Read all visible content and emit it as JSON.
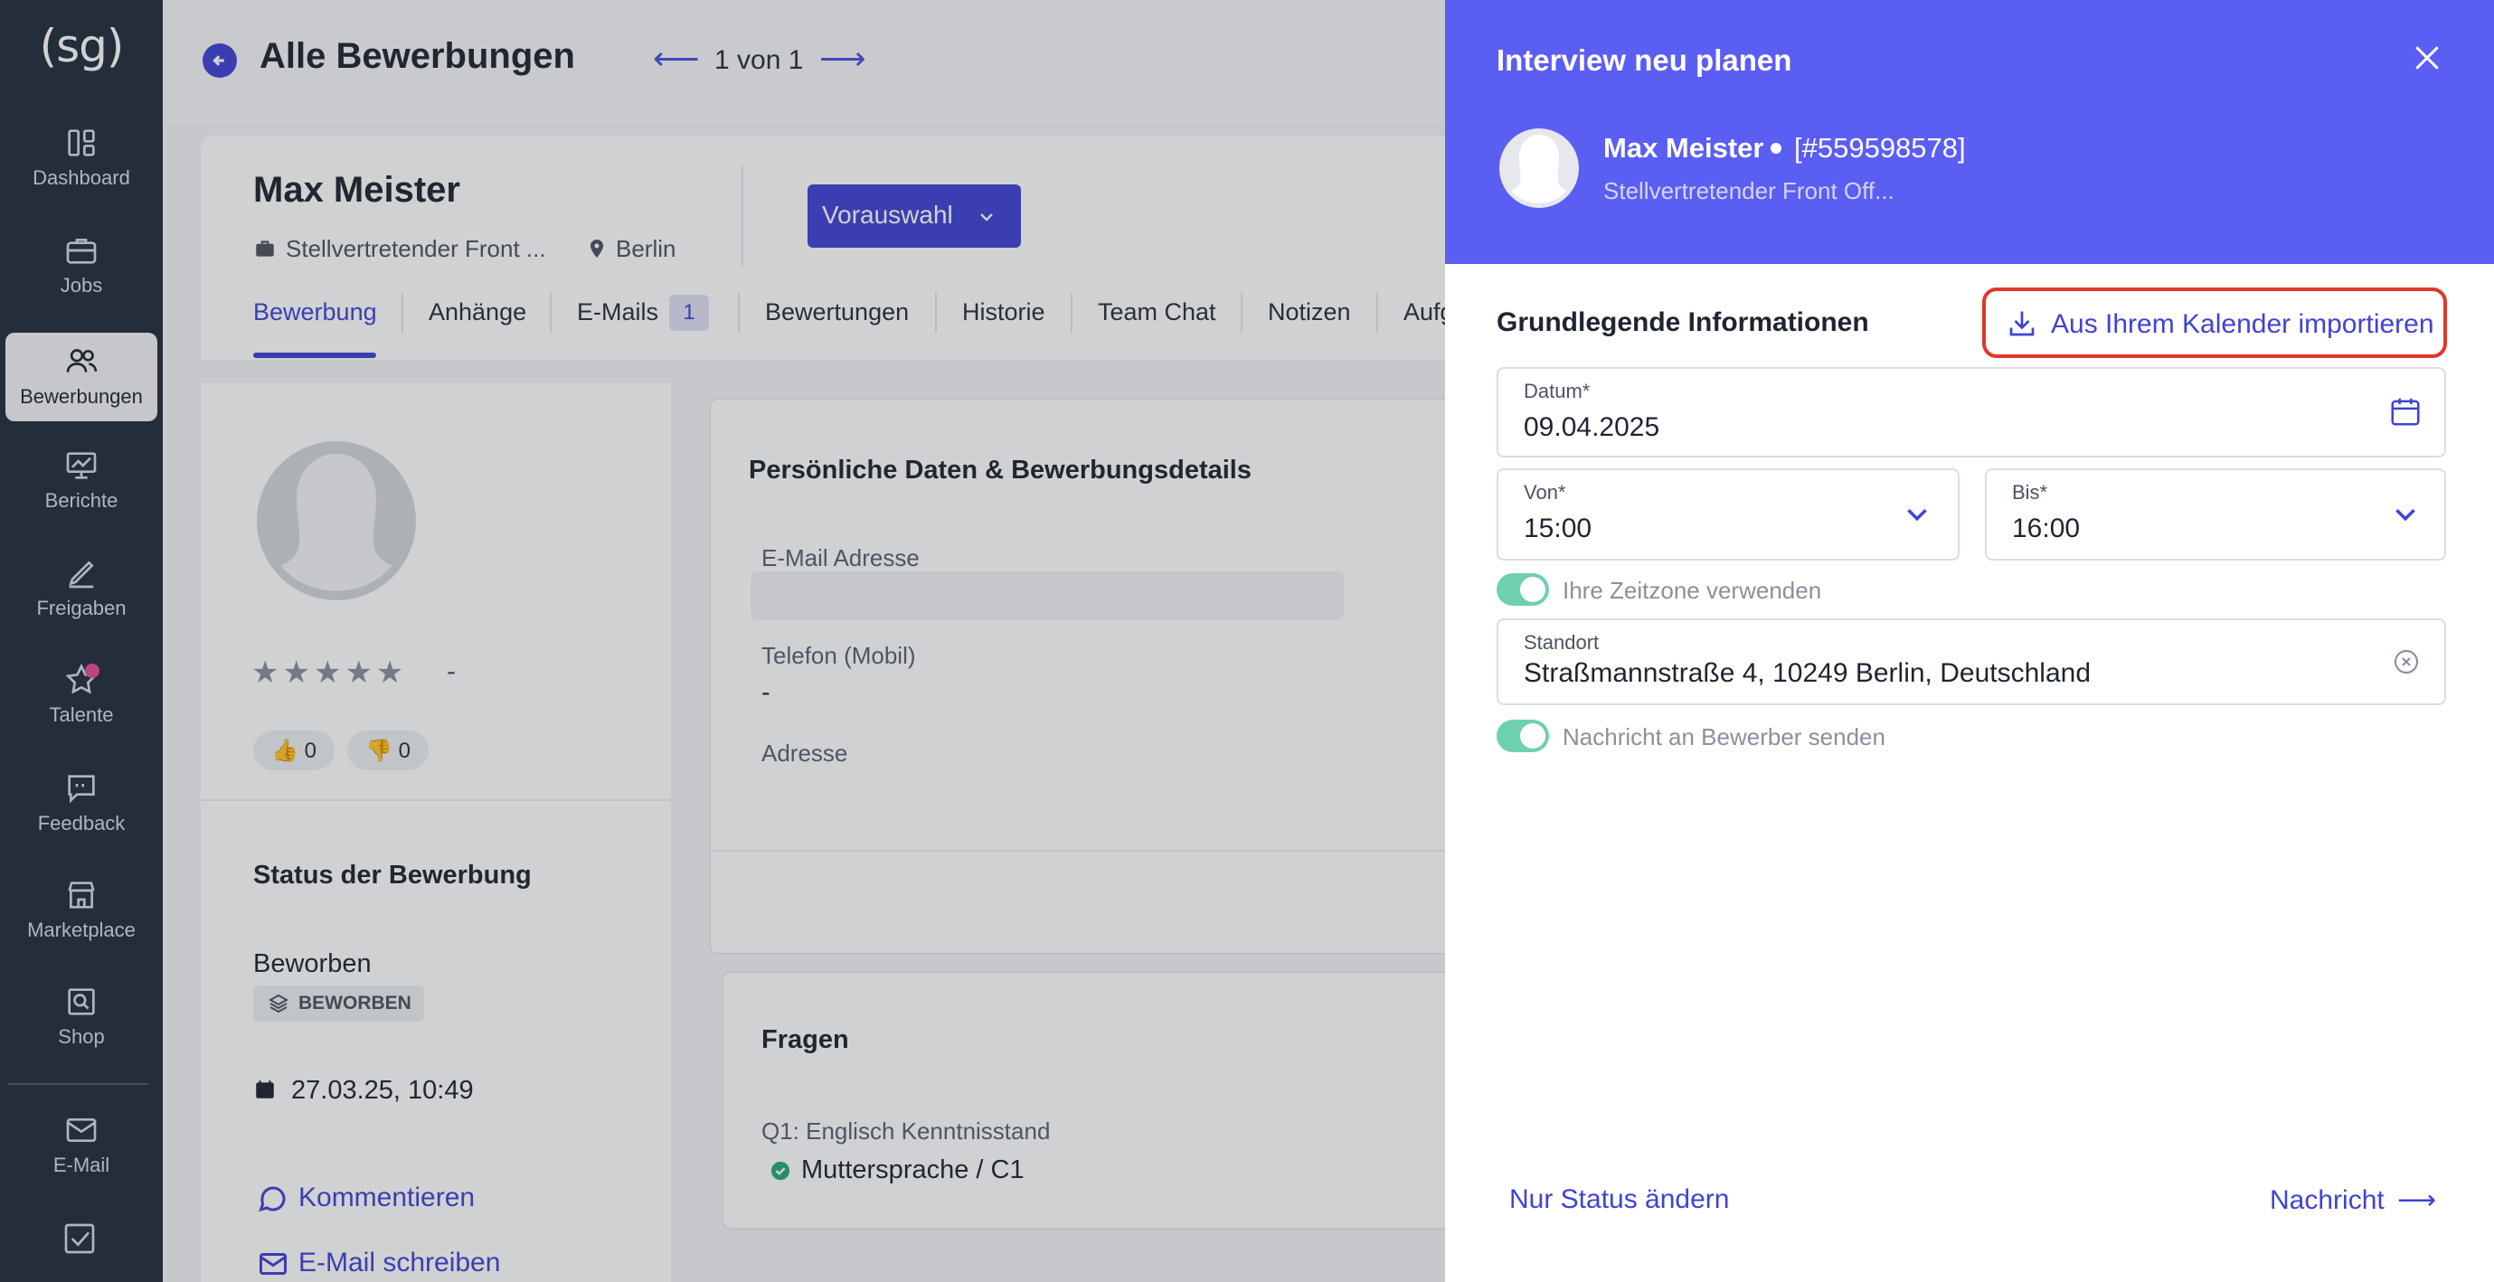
{
  "sidebar": {
    "logo": "(sg)",
    "items": [
      {
        "label": "Dashboard",
        "icon": "dashboard-icon"
      },
      {
        "label": "Jobs",
        "icon": "briefcase-icon"
      },
      {
        "label": "Bewerbungen",
        "icon": "people-icon"
      },
      {
        "label": "Berichte",
        "icon": "chart-board-icon"
      },
      {
        "label": "Freigaben",
        "icon": "pen-icon"
      },
      {
        "label": "Talente",
        "icon": "star-icon"
      },
      {
        "label": "Feedback",
        "icon": "speech-bubble-icon"
      },
      {
        "label": "Marketplace",
        "icon": "store-icon"
      },
      {
        "label": "Shop",
        "icon": "search-document-icon"
      },
      {
        "label": "E-Mail",
        "icon": "mail-icon"
      }
    ]
  },
  "header": {
    "title": "Alle Bewerbungen",
    "pager": "1 von 1"
  },
  "candidate": {
    "name": "Max Meister",
    "job": "Stellvertretender Front ...",
    "location": "Berlin",
    "status_button": "Vorauswahl",
    "tabs": [
      "Bewerbung",
      "Anhänge",
      "E-Mails",
      "Bewertungen",
      "Historie",
      "Team Chat",
      "Notizen",
      "Aufg"
    ],
    "email_count": "1",
    "rating_value": "-",
    "thumbs_up": "0",
    "thumbs_down": "0",
    "status_section": "Status der Bewerbung",
    "status_text": "Beworben",
    "status_badge": "BEWORBEN",
    "date": "27.03.25, 10:49",
    "comment_link": "Kommentieren",
    "email_link": "E-Mail schreiben"
  },
  "details": {
    "title": "Persönliche Daten & Bewerbungsdetails",
    "email_label": "E-Mail Adresse",
    "phone_label": "Telefon (Mobil)",
    "phone_value": "-",
    "address_label": "Adresse"
  },
  "questions": {
    "title": "Fragen",
    "q1_label": "Q1: Englisch Kenntnisstand",
    "q1_answer": "Muttersprache / C1"
  },
  "modal": {
    "title": "Interview neu planen",
    "candidate_name": "Max Meister",
    "candidate_id": "[#559598578]",
    "candidate_job": "Stellvertretender Front Off...",
    "section_title": "Grundlegende Informationen",
    "import_label": "Aus Ihrem Kalender importieren",
    "date_label": "Datum*",
    "date_value": "09.04.2025",
    "from_label": "Von*",
    "from_value": "15:00",
    "to_label": "Bis*",
    "to_value": "16:00",
    "timezone_label": "Ihre Zeitzone verwenden",
    "location_label": "Standort",
    "location_value": "Straßmannstraße 4, 10249 Berlin, Deutschland",
    "notify_label": "Nachricht an Bewerber senden",
    "footer_left": "Nur Status ändern",
    "footer_right": "Nachricht"
  },
  "colors": {
    "accent": "#4043d4",
    "modal_header": "#5b5ef2",
    "sidebar": "#232e3d",
    "toggle_on": "#6fcfb1",
    "highlight_outline": "#e0372b"
  }
}
